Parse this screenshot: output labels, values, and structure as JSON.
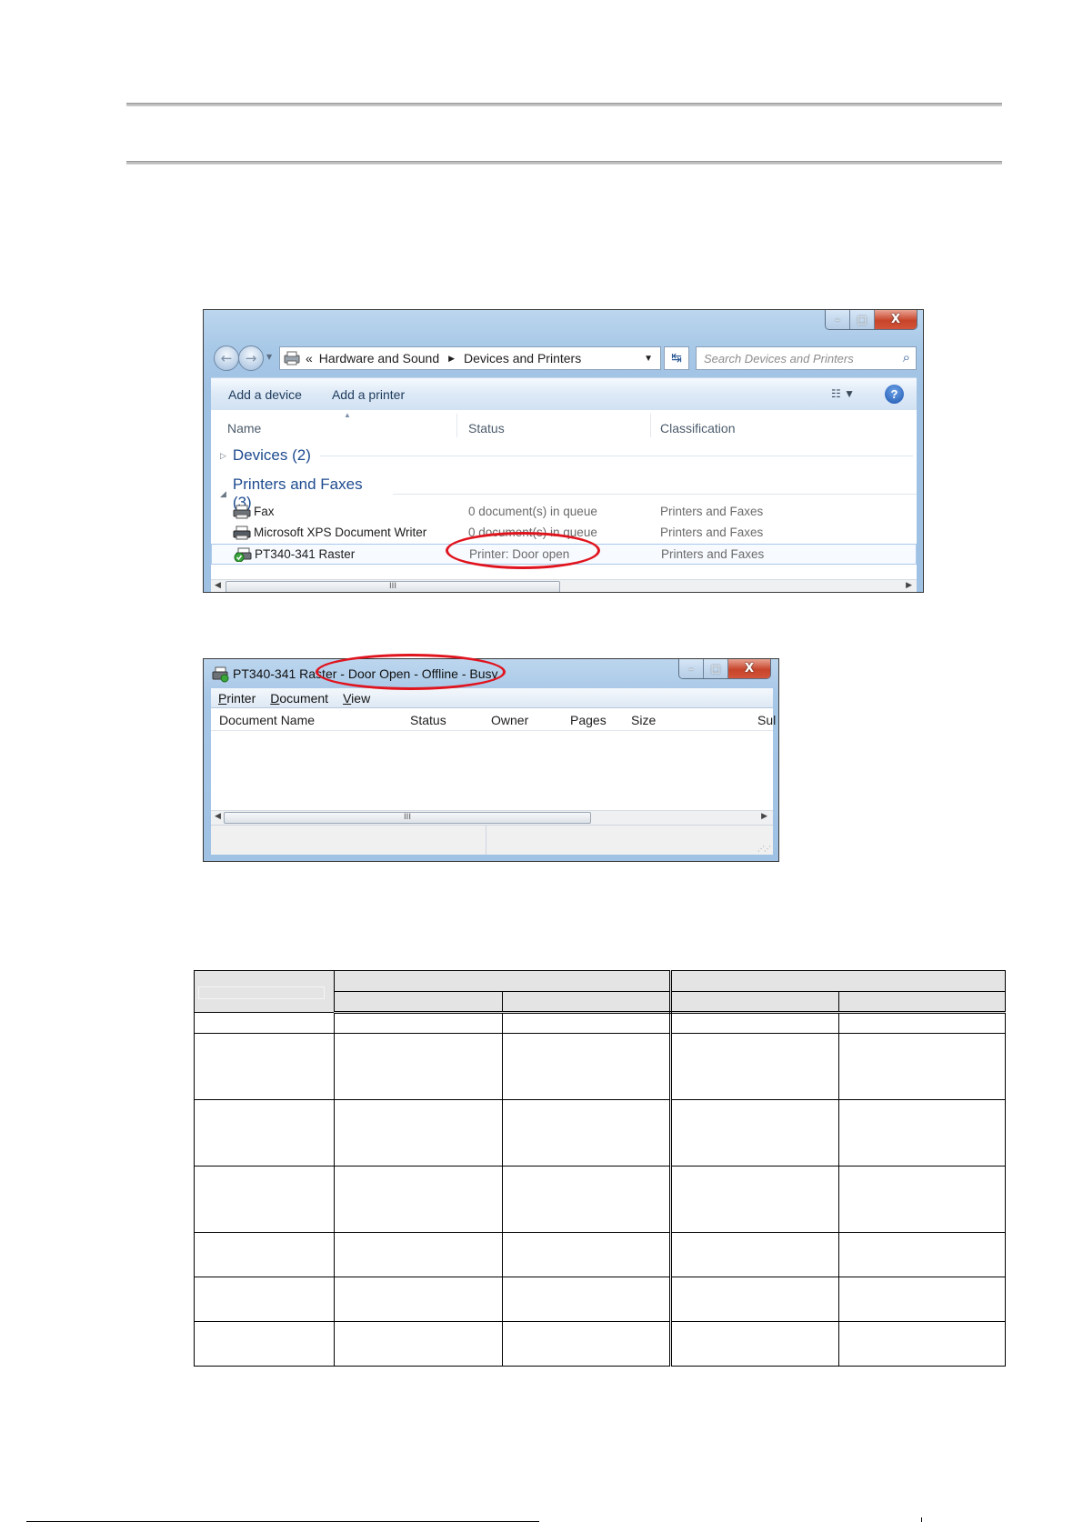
{
  "devices_window": {
    "address": {
      "chevron": "«",
      "crumb1": "Hardware and Sound",
      "crumb2": "Devices and Printers"
    },
    "search_placeholder": "Search Devices and Printers",
    "commands": {
      "add_device": "Add a device",
      "add_printer": "Add a printer"
    },
    "columns": {
      "name": "Name",
      "status": "Status",
      "classification": "Classification"
    },
    "groups": {
      "devices": "Devices (2)",
      "printers": "Printers and Faxes (3)"
    },
    "rows": [
      {
        "name": "Fax",
        "status": "0 document(s) in queue",
        "classification": "Printers and Faxes"
      },
      {
        "name": "Microsoft XPS Document Writer",
        "status": "0 document(s) in queue",
        "classification": "Printers and Faxes"
      },
      {
        "name": "PT340-341 Raster",
        "status": "Printer:  Door open",
        "classification": "Printers and Faxes",
        "selected": true
      }
    ],
    "scroll_grip": "III"
  },
  "queue_window": {
    "title": "PT340-341 Raster - Door Open - Offline - Busy",
    "menu": {
      "printer": "Printer",
      "document": "Document",
      "view": "View"
    },
    "columns": {
      "document_name": "Document Name",
      "status": "Status",
      "owner": "Owner",
      "pages": "Pages",
      "size": "Size",
      "submitted": "Sul"
    },
    "scroll_grip": "III"
  },
  "highlight_color": "#e0141e",
  "window_controls": {
    "minimize": "–",
    "maximize": "□",
    "close": "X"
  }
}
